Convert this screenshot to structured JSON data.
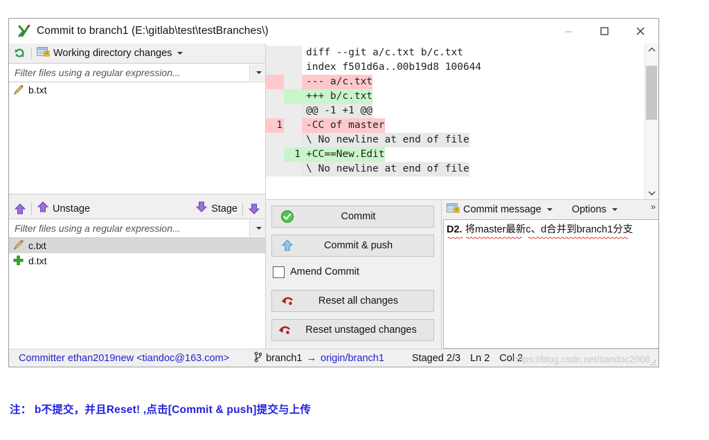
{
  "window": {
    "title": "Commit to branch1 (E:\\gitlab\\test\\testBranches\\)",
    "app_icon": "tortoisegit-icon",
    "minimize_label": "Minimize",
    "maximize_label": "Maximize",
    "close_label": "Close"
  },
  "working_panel": {
    "refresh_icon": "refresh-icon",
    "view_icon": "list-view-icon",
    "title": "Working directory changes",
    "filter_placeholder": "Filter files using a regular expression...",
    "filter_value": "",
    "files": [
      {
        "name": "b.txt",
        "status_icon": "modified-pencil-icon",
        "selected": false
      }
    ]
  },
  "staged_panel": {
    "unstage_icon": "arrow-up-icon",
    "unstage_label": "Unstage",
    "stage_label": "Stage",
    "stage_icon": "arrow-down-icon",
    "filter_placeholder": "Filter files using a regular expression...",
    "filter_value": "",
    "files": [
      {
        "name": "c.txt",
        "status_icon": "modified-pencil-icon",
        "selected": true
      },
      {
        "name": "d.txt",
        "status_icon": "added-plus-icon",
        "selected": false
      }
    ]
  },
  "diff": {
    "lines": [
      {
        "old": "",
        "new": "",
        "text": "diff --git a/c.txt b/c.txt",
        "kind": "head"
      },
      {
        "old": "",
        "new": "",
        "text": "index f501d6a..00b19d8 100644",
        "kind": "head"
      },
      {
        "old": "",
        "new": "",
        "text": "--- a/c.txt",
        "kind": "minus"
      },
      {
        "old": "",
        "new": "",
        "text": "+++ b/c.txt",
        "kind": "plus"
      },
      {
        "old": "",
        "new": "",
        "text": "@@ -1 +1 @@",
        "kind": "hunk"
      },
      {
        "old": "1",
        "new": "",
        "text": "-CC of master",
        "kind": "minus"
      },
      {
        "old": "",
        "new": "",
        "text": "\\ No newline at end of file",
        "kind": "ctx"
      },
      {
        "old": "",
        "new": "1",
        "text": "+CC==New.Edit",
        "kind": "plus"
      },
      {
        "old": "",
        "new": "",
        "text": "\\ No newline at end of file",
        "kind": "ctx"
      }
    ],
    "scroll_up_icon": "chevron-up-icon",
    "scroll_down_icon": "chevron-down-icon"
  },
  "actions": {
    "commit_label": "Commit",
    "commit_icon": "green-check-icon",
    "commit_push_label": "Commit & push",
    "commit_push_icon": "blue-up-arrow-icon",
    "amend_label": "Amend Commit",
    "amend_checked": false,
    "reset_all_label": "Reset all changes",
    "reset_all_icon": "red-undo-icon",
    "reset_unstaged_label": "Reset unstaged changes",
    "reset_unstaged_icon": "red-undo-icon"
  },
  "message_panel": {
    "icon": "message-card-icon",
    "title": "Commit message",
    "options_label": "Options",
    "more_label": "»",
    "text_prefix": "D2.",
    "text_body": "将master最新c、d合并到branch1分支"
  },
  "statusbar": {
    "committer": "Committer ethan2019new <tiandoc@163.com>",
    "branch_icon": "branch-icon",
    "branch": "branch1",
    "arrow": "→",
    "remote": "origin/branch1",
    "staged": "Staged  2/3",
    "line": "Ln  2",
    "col": "Col  2",
    "watermark": "https://blog.csdn.net/tiandoc2008"
  },
  "annotation": {
    "text": "注： b不提交，并且Reset! ,点击[Commit & push]提交与上传"
  },
  "colors": {
    "diff_add": "#c9f5cb",
    "diff_del": "#ffc9cc",
    "link": "#2222cc",
    "annotation": "#2020e0"
  }
}
